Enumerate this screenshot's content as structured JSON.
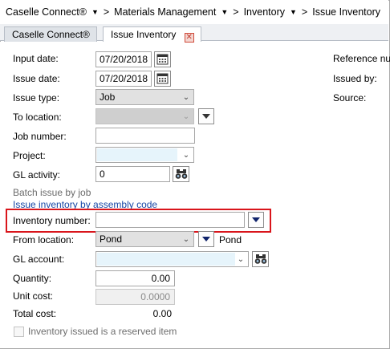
{
  "breadcrumb": [
    {
      "label": "Caselle Connect®"
    },
    {
      "label": "Materials Management"
    },
    {
      "label": "Inventory"
    },
    {
      "label": "Issue Inventory"
    }
  ],
  "tabs": [
    {
      "label": "Caselle Connect®",
      "active": false
    },
    {
      "label": "Issue Inventory",
      "active": true
    }
  ],
  "form": {
    "input_date": {
      "label": "Input date:",
      "value": "07/20/2018"
    },
    "issue_date": {
      "label": "Issue date:",
      "value": "07/20/2018"
    },
    "issue_type": {
      "label": "Issue type:",
      "value": "Job"
    },
    "to_location": {
      "label": "To location:",
      "value": ""
    },
    "job_number": {
      "label": "Job number:",
      "value": ""
    },
    "project": {
      "label": "Project:",
      "value": ""
    },
    "gl_activity": {
      "label": "GL activity:",
      "value": "0"
    },
    "batch_issue_link": "Batch issue by job",
    "issue_by_assembly_link": "Issue inventory by assembly code",
    "inventory_number": {
      "label": "Inventory number:",
      "value": ""
    },
    "from_location": {
      "label": "From location:",
      "value": "Pond",
      "description": "Pond"
    },
    "gl_account": {
      "label": "GL account:",
      "value": ""
    },
    "quantity": {
      "label": "Quantity:",
      "value": "0.00"
    },
    "unit_cost": {
      "label": "Unit cost:",
      "value": "0.0000"
    },
    "total_cost": {
      "label": "Total cost:",
      "value": "0.00"
    },
    "reserved_checkbox": {
      "label": "Inventory issued is a reserved item",
      "checked": false
    }
  },
  "right_panel": {
    "reference_label": "Reference num",
    "issued_by_label": "Issued by:",
    "source_label": "Source:"
  },
  "colors": {
    "highlight": "#d9151b",
    "link": "#1747a6",
    "dropdown_arrow": "#10236b"
  },
  "icons": {
    "calendar": "calendar-icon",
    "find": "binoculars-icon",
    "tab_close": "close-icon"
  }
}
